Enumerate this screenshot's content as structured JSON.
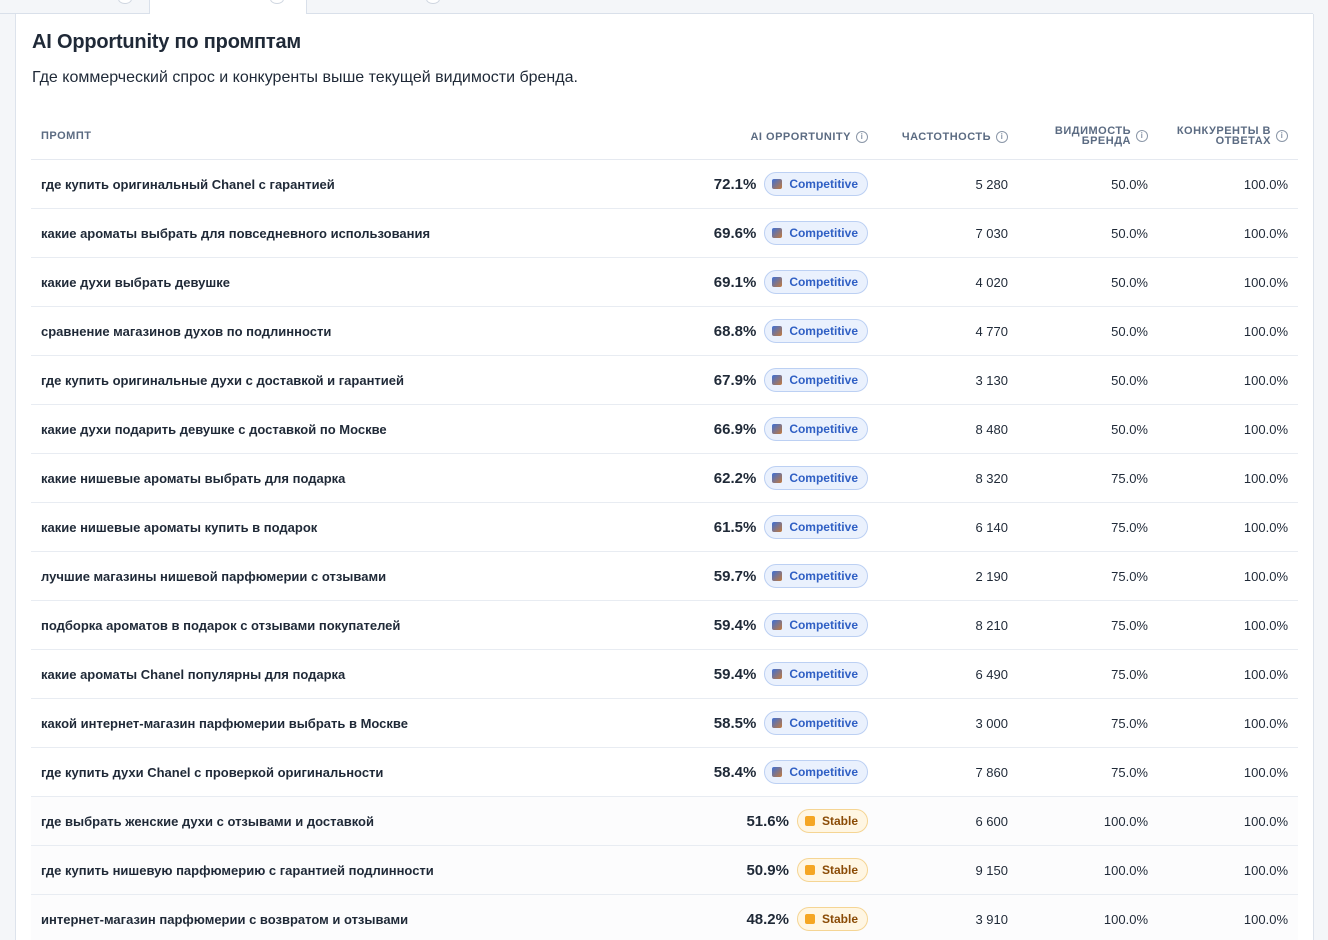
{
  "section": {
    "title": "AI Opportunity по промптам",
    "subtitle": "Где коммерческий спрос и конкуренты выше текущей видимости бренда."
  },
  "columns": {
    "prompt": "ПРОМПТ",
    "opportunity": "AI OPPORTUNITY",
    "frequency": "ЧАСТОТНОСТЬ",
    "visibility_l1": "ВИДИМОСТЬ",
    "visibility_l2": "БРЕНДА",
    "competitors_l1": "КОНКУРЕНТЫ В",
    "competitors_l2": "ОТВЕТАХ",
    "info_glyph": "i"
  },
  "colors": {
    "competitive_text": "#2f5fc4",
    "stable_text": "#8a4b06",
    "stable_marker": "#f5a623"
  },
  "rows": [
    {
      "prompt": "где купить оригинальный Chanel с гарантией",
      "opportunity": "72.1%",
      "status": "Competitive",
      "frequency": "5 280",
      "visibility": "50.0%",
      "competitors": "100.0%"
    },
    {
      "prompt": "какие ароматы выбрать для повседневного использования",
      "opportunity": "69.6%",
      "status": "Competitive",
      "frequency": "7 030",
      "visibility": "50.0%",
      "competitors": "100.0%"
    },
    {
      "prompt": "какие духи выбрать девушке",
      "opportunity": "69.1%",
      "status": "Competitive",
      "frequency": "4 020",
      "visibility": "50.0%",
      "competitors": "100.0%"
    },
    {
      "prompt": "сравнение магазинов духов по подлинности",
      "opportunity": "68.8%",
      "status": "Competitive",
      "frequency": "4 770",
      "visibility": "50.0%",
      "competitors": "100.0%"
    },
    {
      "prompt": "где купить оригинальные духи с доставкой и гарантией",
      "opportunity": "67.9%",
      "status": "Competitive",
      "frequency": "3 130",
      "visibility": "50.0%",
      "competitors": "100.0%"
    },
    {
      "prompt": "какие духи подарить девушке с доставкой по Москве",
      "opportunity": "66.9%",
      "status": "Competitive",
      "frequency": "8 480",
      "visibility": "50.0%",
      "competitors": "100.0%"
    },
    {
      "prompt": "какие нишевые ароматы выбрать для подарка",
      "opportunity": "62.2%",
      "status": "Competitive",
      "frequency": "8 320",
      "visibility": "75.0%",
      "competitors": "100.0%"
    },
    {
      "prompt": "какие нишевые ароматы купить в подарок",
      "opportunity": "61.5%",
      "status": "Competitive",
      "frequency": "6 140",
      "visibility": "75.0%",
      "competitors": "100.0%"
    },
    {
      "prompt": "лучшие магазины нишевой парфюмерии с отзывами",
      "opportunity": "59.7%",
      "status": "Competitive",
      "frequency": "2 190",
      "visibility": "75.0%",
      "competitors": "100.0%"
    },
    {
      "prompt": "подборка ароматов в подарок с отзывами покупателей",
      "opportunity": "59.4%",
      "status": "Competitive",
      "frequency": "8 210",
      "visibility": "75.0%",
      "competitors": "100.0%"
    },
    {
      "prompt": "какие ароматы Chanel популярны для подарка",
      "opportunity": "59.4%",
      "status": "Competitive",
      "frequency": "6 490",
      "visibility": "75.0%",
      "competitors": "100.0%"
    },
    {
      "prompt": "какой интернет-магазин парфюмерии выбрать в Москве",
      "opportunity": "58.5%",
      "status": "Competitive",
      "frequency": "3 000",
      "visibility": "75.0%",
      "competitors": "100.0%"
    },
    {
      "prompt": "где купить духи Chanel с проверкой оригинальности",
      "opportunity": "58.4%",
      "status": "Competitive",
      "frequency": "7 860",
      "visibility": "75.0%",
      "competitors": "100.0%"
    },
    {
      "prompt": "где выбрать женские духи с отзывами и доставкой",
      "opportunity": "51.6%",
      "status": "Stable",
      "frequency": "6 600",
      "visibility": "100.0%",
      "competitors": "100.0%"
    },
    {
      "prompt": "где купить нишевую парфюмерию с гарантией подлинности",
      "opportunity": "50.9%",
      "status": "Stable",
      "frequency": "9 150",
      "visibility": "100.0%",
      "competitors": "100.0%"
    },
    {
      "prompt": "интернет-магазин парфюмерии с возвратом и отзывами",
      "opportunity": "48.2%",
      "status": "Stable",
      "frequency": "3 910",
      "visibility": "100.0%",
      "competitors": "100.0%"
    }
  ]
}
